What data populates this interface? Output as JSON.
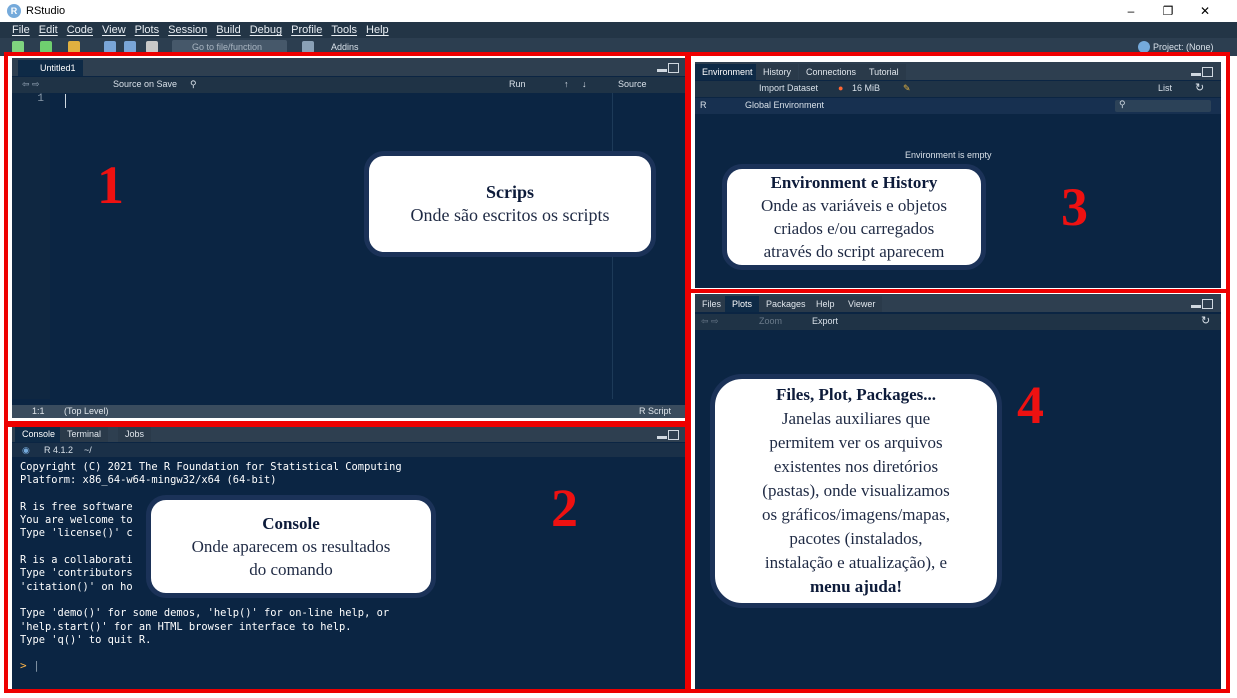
{
  "window": {
    "app_icon": "R",
    "title": "RStudio",
    "controls": [
      "–",
      "❐",
      "✕"
    ]
  },
  "menu": [
    "File",
    "Edit",
    "Code",
    "View",
    "Plots",
    "Session",
    "Build",
    "Debug",
    "Profile",
    "Tools",
    "Help"
  ],
  "toolbar": {
    "goto_placeholder": "Go to file/function",
    "addins_label": "Addins",
    "project_label": "Project: (None)"
  },
  "editor": {
    "tab_label": "Untitled1",
    "source_on_save_label": "Source on Save",
    "run_label": "Run",
    "source_label": "Source",
    "line_number": "1",
    "status_position": "1:1",
    "status_scope": "(Top Level)",
    "status_filetype": "R Script"
  },
  "console_pane": {
    "tabs": [
      "Console",
      "Terminal",
      "Jobs"
    ],
    "version": "R 4.1.2",
    "path": "~/",
    "lines": [
      "Copyright (C) 2021 The R Foundation for Statistical Computing",
      "Platform: x86_64-w64-mingw32/x64 (64-bit)",
      "",
      "R is free software",
      "You are welcome to",
      "Type 'license()' c",
      "",
      "R is a collaborati",
      "Type 'contributors",
      "'citation()' on ho",
      "",
      "Type 'demo()' for some demos, 'help()' for on-line help, or",
      "'help.start()' for an HTML browser interface to help.",
      "Type 'q()' to quit R."
    ],
    "prompt": ">"
  },
  "env_pane": {
    "tabs": [
      "Environment",
      "History",
      "Connections",
      "Tutorial"
    ],
    "import_label": "Import Dataset",
    "memory_label": "16 MiB",
    "list_label": "List",
    "r_label": "R",
    "global_env_label": "Global Environment",
    "empty_message": "Environment is empty"
  },
  "files_pane": {
    "tabs": [
      "Files",
      "Plots",
      "Packages",
      "Help",
      "Viewer"
    ],
    "zoom_label": "Zoom",
    "export_label": "Export"
  },
  "annotations": {
    "n1": "1",
    "n2": "2",
    "n3": "3",
    "n4": "4",
    "scripts_title": "Scrips",
    "scripts_text": "Onde são escritos os scripts",
    "console_title": "Console",
    "console_text1": "Onde aparecem os resultados",
    "console_text2": "do comando",
    "env_title": "Environment e History",
    "env_text1": "Onde as variáveis e objetos",
    "env_text2": "criados e/ou carregados",
    "env_text3": "através do script aparecem",
    "files_title": "Files, Plot, Packages...",
    "files_lines": [
      "Janelas auxiliares que",
      "permitem ver os arquivos",
      "existentes nos diretórios",
      "(pastas), onde visualizamos",
      "os gráficos/imagens/mapas,",
      "pacotes (instalados,",
      "instalação e atualização), e"
    ],
    "files_bold": "menu ajuda!"
  },
  "colors": {
    "pane_bg": "#0b2543",
    "highlight_red": "#ee0000",
    "callout_border": "#1b3258"
  }
}
